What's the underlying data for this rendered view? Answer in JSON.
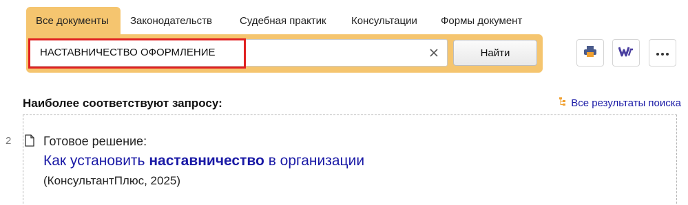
{
  "tabs": [
    {
      "label": "Все документы",
      "active": true
    },
    {
      "label": "Законодательств",
      "active": false
    },
    {
      "label": "Судебная практик",
      "active": false
    },
    {
      "label": "Консультации",
      "active": false
    },
    {
      "label": "Формы документ",
      "active": false
    }
  ],
  "search": {
    "value": "НАСТАВНИЧЕСТВО ОФОРМЛЕНИЕ",
    "find_label": "Найти",
    "clear_icon": "close-icon"
  },
  "toolbar": {
    "print_icon": "printer-icon",
    "word_icon": "word-export-icon",
    "more_icon": "more-dots-icon"
  },
  "results": {
    "heading": "Наиболее соответствуют запросу:",
    "all_results_label": "Все результаты поиска",
    "items": [
      {
        "number": "2",
        "kind": "Готовое решение:",
        "title_before": "Как установить ",
        "title_bold": "наставничество",
        "title_after": " в организации",
        "source": "(КонсультантПлюс, 2025)"
      }
    ]
  },
  "colors": {
    "accent": "#f5c56f",
    "link": "#1a1aa6",
    "highlight": "#e02020"
  }
}
